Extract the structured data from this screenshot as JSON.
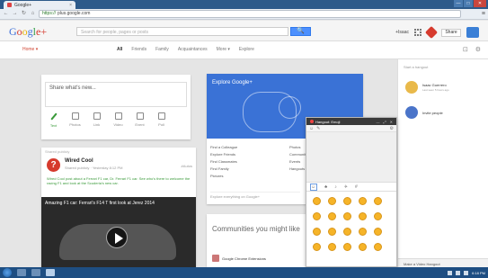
{
  "browser": {
    "tab_title": "Google+",
    "tab_close": "×",
    "window_buttons": [
      "—",
      "□",
      "✕"
    ],
    "url_scheme": "https://",
    "url_path": "plus.google.com",
    "menu": "≡"
  },
  "header": {
    "search_placeholder": "Search for people, pages or posts",
    "search_button": "🔍",
    "user_name": "+Isaac",
    "share_label": "Share"
  },
  "subnav": {
    "home": "Home ▾",
    "items": [
      "All",
      "Friends",
      "Family",
      "Acquaintances",
      "More ▾",
      "Explore"
    ]
  },
  "share_box": {
    "placeholder": "Share what's new...",
    "actions": [
      "Text",
      "Photos",
      "Link",
      "Video",
      "Event",
      "Poll"
    ]
  },
  "post": {
    "top_text": "Shared publicly",
    "avatar_letter": "?",
    "author": "Wired Cool",
    "meta": "Shared publicly · Yesterday 8:12 PM",
    "tag": "#Autos",
    "text": "Wired Cool post about a Ferrari F1 car, Dr. Ferrari F1 car. See who's there to welcome the racing F1 and look at the Scuderia's new car.",
    "video_title": "Amazing F1 car: Ferrari's F14 T first look at Jerez 2014"
  },
  "explore": {
    "title": "Explore Google+",
    "list_left": [
      "Find a Colleague",
      "Explore Friends",
      "Find Classmates",
      "Find Family",
      "Pictures"
    ],
    "list_right": [
      "Photos",
      "Communities",
      "Events",
      "Hangouts"
    ],
    "footer": "Explore everything on Google+"
  },
  "communities": {
    "title": "Communities you might like",
    "item": "Google Chrome Extensions"
  },
  "sidebar": {
    "top": "Start a hangout",
    "contacts": [
      {
        "name": "Isaac Guerrero",
        "status": "Last seen 5 hours ago"
      },
      {
        "name": "Invite people",
        "status": ""
      }
    ],
    "bottom": "Make a Video Hangout"
  },
  "emoji_popup": {
    "title": "Hangout: Emoji",
    "controls": [
      "—",
      "⤢",
      "✕"
    ],
    "tools_left": [
      "☺",
      "✎"
    ],
    "tools_right": "⚙",
    "tabs": [
      "☺",
      "♣",
      "♪",
      "✈",
      "#"
    ],
    "emoji_count": 20
  },
  "taskbar": {
    "tray_time": "6:18 PM"
  },
  "colors": {
    "accent_blue": "#4d90fe",
    "google_red": "#d14836",
    "banner_blue": "#3a72d6"
  }
}
